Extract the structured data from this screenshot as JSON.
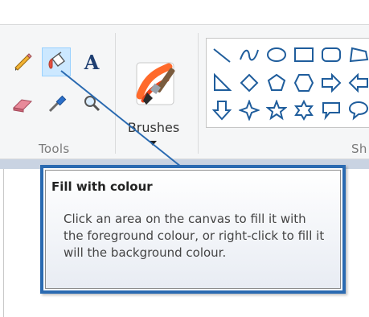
{
  "ribbon": {
    "tools_group": {
      "label": "Tools",
      "items": [
        {
          "name": "pencil-icon"
        },
        {
          "name": "fill-bucket-icon",
          "selected": true
        },
        {
          "name": "text-icon",
          "glyph": "A"
        },
        {
          "name": "eraser-icon"
        },
        {
          "name": "color-picker-icon"
        },
        {
          "name": "magnifier-icon"
        }
      ]
    },
    "brushes": {
      "label": "Brushes",
      "icon": "brush-icon"
    },
    "shapes_group": {
      "label": "Sh",
      "items": [
        "line-icon",
        "curve-icon",
        "oval-icon",
        "rectangle-icon",
        "rounded-rectangle-icon",
        "right-triangle-icon",
        "diamond-icon",
        "pentagon-icon",
        "hexagon-icon",
        "right-arrow-icon",
        "down-arrow-icon",
        "four-point-star-icon",
        "five-point-star-icon",
        "six-point-star-icon",
        "callout-icon"
      ]
    }
  },
  "tooltip": {
    "title": "Fill with colour",
    "body": "Click an area on the canvas to fill it with the foreground colour, or right-click to fill it will the background colour."
  },
  "colors": {
    "accent_blue": "#2a6ab1",
    "selected_bg": "#cce8ff",
    "icon_blue": "#1f5d9c"
  }
}
